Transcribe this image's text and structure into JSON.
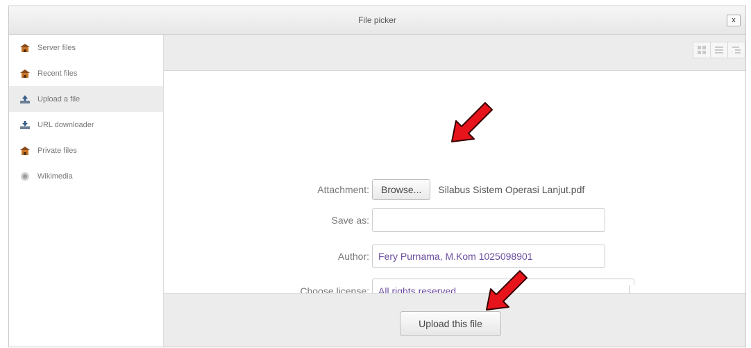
{
  "dialog": {
    "title": "File picker",
    "close_label": "x"
  },
  "sidebar": {
    "items": [
      {
        "label": "Server files",
        "icon": "folder-home-icon"
      },
      {
        "label": "Recent files",
        "icon": "folder-home-icon"
      },
      {
        "label": "Upload a file",
        "icon": "upload-icon",
        "active": true
      },
      {
        "label": "URL downloader",
        "icon": "download-icon"
      },
      {
        "label": "Private files",
        "icon": "folder-home-icon"
      },
      {
        "label": "Wikimedia",
        "icon": "wikimedia-icon"
      }
    ]
  },
  "toolbar": {
    "view_icons": [
      "grid-view-icon",
      "list-view-icon",
      "tree-view-icon"
    ]
  },
  "form": {
    "attachment_label": "Attachment:",
    "browse_label": "Browse...",
    "selected_file": "Silabus Sistem Operasi Lanjut.pdf",
    "saveas_label": "Save as:",
    "saveas_value": "",
    "author_label": "Author:",
    "author_value": "Fery Purnama, M.Kom 1025098901",
    "license_label": "Choose license:",
    "license_value": "All rights reserved",
    "upload_label": "Upload this file"
  },
  "colors": {
    "arrow": "#e8141c",
    "link_text": "#6a4ca0"
  }
}
